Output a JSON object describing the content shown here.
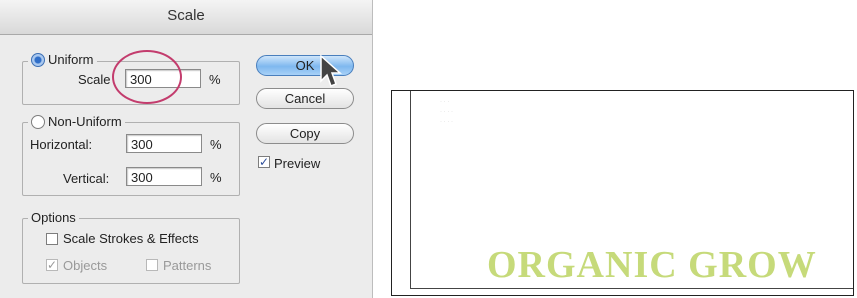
{
  "dialog": {
    "title": "Scale",
    "uniform": {
      "label": "Uniform",
      "selected": true,
      "scale_label": "Scale",
      "scale_value": "300",
      "unit": "%"
    },
    "non_uniform": {
      "label": "Non-Uniform",
      "selected": false,
      "horizontal_label": "Horizontal:",
      "horizontal_value": "300",
      "horizontal_unit": "%",
      "vertical_label": "Vertical:",
      "vertical_value": "300",
      "vertical_unit": "%"
    },
    "options": {
      "label": "Options",
      "scale_strokes_label": "Scale Strokes & Effects",
      "scale_strokes_checked": false,
      "objects_label": "Objects",
      "objects_checked": true,
      "patterns_label": "Patterns",
      "patterns_checked": false
    },
    "buttons": {
      "ok": "OK",
      "cancel": "Cancel",
      "copy": "Copy"
    },
    "preview": {
      "label": "Preview",
      "checked": true
    }
  },
  "canvas": {
    "text": "ORGANIC GROW",
    "text_color": "#c6da7a",
    "small_lines": [
      "· · ·",
      "· · · ·",
      "· · · ·"
    ]
  },
  "colors": {
    "highlight_circle": "#c33c6d",
    "primary_button": "#7fb8ef"
  }
}
